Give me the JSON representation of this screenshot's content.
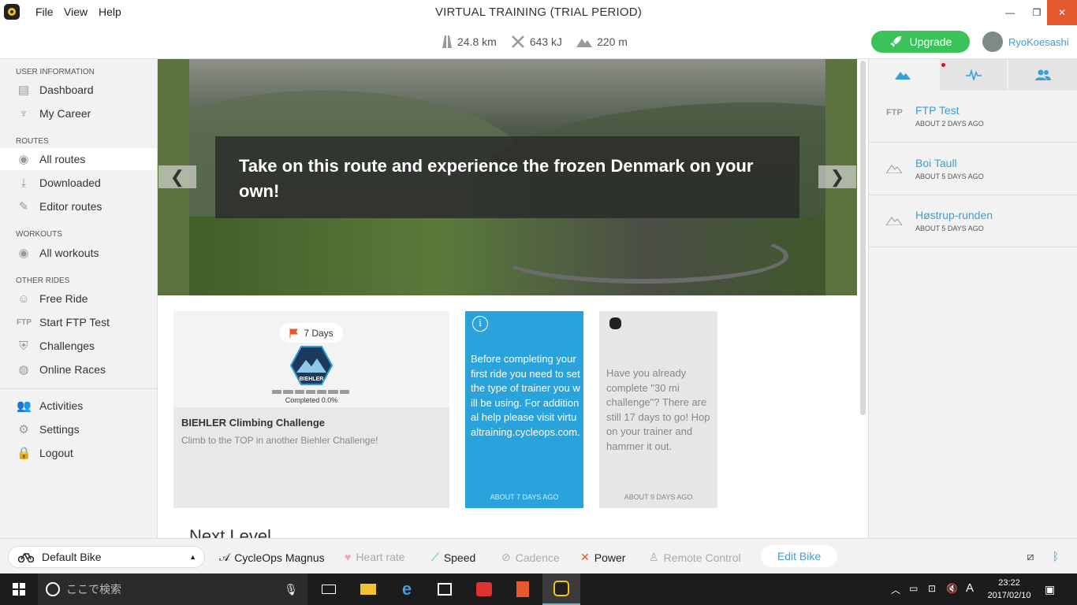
{
  "window": {
    "title": "VIRTUAL TRAINING (TRIAL PERIOD)",
    "minimize": "—",
    "maximize": "❐",
    "close": "✕"
  },
  "menu": [
    "File",
    "View",
    "Help"
  ],
  "stats": {
    "distance": "24.8 km",
    "energy": "643 kJ",
    "elevation": "220 m"
  },
  "header": {
    "upgrade_label": "Upgrade",
    "username": "RyoKoesashi"
  },
  "sidebar": {
    "sections": {
      "user": "USER INFORMATION",
      "routes": "ROUTES",
      "workouts": "WORKOUTS",
      "other": "OTHER RIDES"
    },
    "items": {
      "dashboard": "Dashboard",
      "career": "My Career",
      "all_routes": "All routes",
      "downloaded": "Downloaded",
      "editor_routes": "Editor routes",
      "all_workouts": "All workouts",
      "free_ride": "Free Ride",
      "ftp_test": "Start FTP Test",
      "challenges": "Challenges",
      "online_races": "Online Races",
      "activities": "Activities",
      "settings": "Settings",
      "logout": "Logout"
    },
    "ftp_icon": "FTP"
  },
  "hero": {
    "text": "Take on this route and experience the frozen Denmark on your own!"
  },
  "cards": {
    "challenge": {
      "days": "7 Days",
      "completed": "Completed 0.0%",
      "title": "BIEHLER Climbing Challenge",
      "desc": "Climb to the TOP in another Biehler Challenge!",
      "progress": 0.0,
      "badge_text": "BIEHLER"
    },
    "info": {
      "icon": "i",
      "text": "Before completing your first ride you need to set the type of trainer you will be using. For additional help please visit virtualtraining.cycleops.com.",
      "time": "ABOUT 7 DAYS AGO"
    },
    "reminder": {
      "text": "Have you already complete \"30 mi challenge\"? There are still 17 days to go! Hop on your trainer and hammer it out.",
      "time": "ABOUT 9 DAYS AGO"
    }
  },
  "next_level": "Next Level",
  "activities": [
    {
      "name": "FTP Test",
      "time": "ABOUT 2 DAYS AGO",
      "icon": "FTP"
    },
    {
      "name": "Boi Taull",
      "time": "ABOUT 5 DAYS AGO",
      "icon": "mountain"
    },
    {
      "name": "Høstrup-runden",
      "time": "ABOUT 5 DAYS AGO",
      "icon": "mountain"
    }
  ],
  "bottombar": {
    "bike": "Default Bike",
    "trainer": "CycleOps Magnus",
    "heart_rate": "Heart rate",
    "speed": "Speed",
    "cadence": "Cadence",
    "power": "Power",
    "remote": "Remote Control",
    "edit_bike": "Edit Bike"
  },
  "taskbar": {
    "search_placeholder": "ここで検索",
    "ime": "A",
    "time": "23:22",
    "date": "2017/02/10"
  },
  "colors": {
    "accent": "#3a9fd6",
    "upgrade": "#3cc25a",
    "info_card": "#2aa3dd",
    "close": "#e4582e",
    "logout_icon": "#e4582e"
  }
}
